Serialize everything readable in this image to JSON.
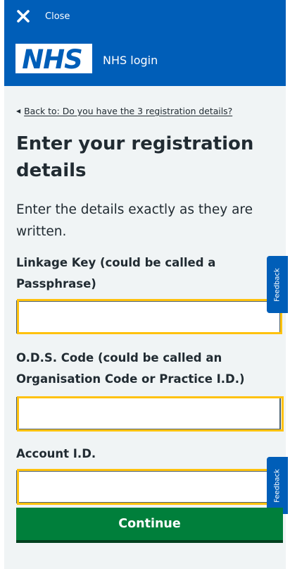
{
  "header": {
    "close_label": "Close",
    "logo_text": "NHS",
    "brand_label": "NHS login",
    "close_icon": "close-icon",
    "background_color": "#005eb8"
  },
  "back_link": {
    "arrow": "◀",
    "label": "Back to: Do you have the 3 registration details?"
  },
  "page": {
    "title": "Enter your registration details",
    "lead": "Enter the details exactly as they are written."
  },
  "form": {
    "fields": [
      {
        "label": "Linkage Key (could be called a Passphrase)",
        "value": ""
      },
      {
        "label": "O.D.S. Code (could be called an Organisation Code or Practice I.D.)",
        "value": ""
      },
      {
        "label": "Account I.D.",
        "value": ""
      }
    ],
    "submit_label": "Continue",
    "submit_color": "#007f3b",
    "highlight_color": "#ffc20e"
  },
  "feedback_tab": {
    "label": "Feedback",
    "color": "#005eb8"
  }
}
